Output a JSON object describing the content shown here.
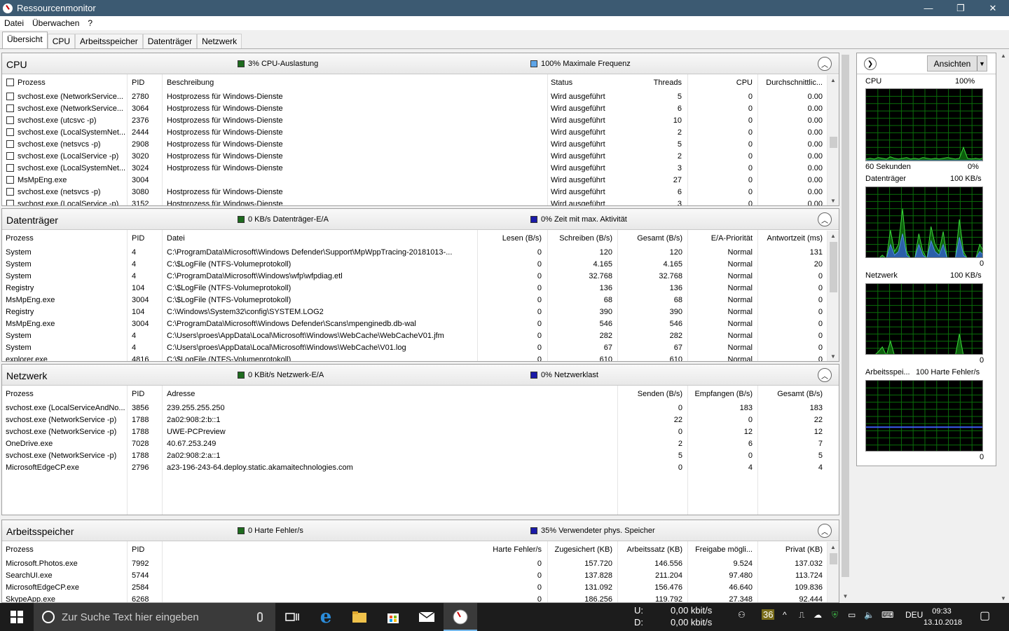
{
  "window": {
    "title": "Ressourcenmonitor",
    "controls": [
      "—",
      "❐",
      "✕"
    ]
  },
  "menu": [
    "Datei",
    "Überwachen",
    "?"
  ],
  "tabs": [
    "Übersicht",
    "CPU",
    "Arbeitsspeicher",
    "Datenträger",
    "Netzwerk"
  ],
  "cpu": {
    "title": "CPU",
    "stat1": "3% CPU-Auslastung",
    "stat1_color": "#1e6b1e",
    "stat2": "100% Maximale Frequenz",
    "stat2_color": "#5ea5e8",
    "headers": [
      "Prozess",
      "PID",
      "Beschreibung",
      "Status",
      "Threads",
      "CPU",
      "Durchschnittlic..."
    ],
    "rows": [
      [
        "svchost.exe (NetworkService...",
        "2780",
        "Hostprozess für Windows-Dienste",
        "Wird ausgeführt",
        "5",
        "0",
        "0.00"
      ],
      [
        "svchost.exe (NetworkService...",
        "3064",
        "Hostprozess für Windows-Dienste",
        "Wird ausgeführt",
        "6",
        "0",
        "0.00"
      ],
      [
        "svchost.exe (utcsvc -p)",
        "2376",
        "Hostprozess für Windows-Dienste",
        "Wird ausgeführt",
        "10",
        "0",
        "0.00"
      ],
      [
        "svchost.exe (LocalSystemNet...",
        "2444",
        "Hostprozess für Windows-Dienste",
        "Wird ausgeführt",
        "2",
        "0",
        "0.00"
      ],
      [
        "svchost.exe (netsvcs -p)",
        "2908",
        "Hostprozess für Windows-Dienste",
        "Wird ausgeführt",
        "5",
        "0",
        "0.00"
      ],
      [
        "svchost.exe (LocalService -p)",
        "3020",
        "Hostprozess für Windows-Dienste",
        "Wird ausgeführt",
        "2",
        "0",
        "0.00"
      ],
      [
        "svchost.exe (LocalSystemNet...",
        "3024",
        "Hostprozess für Windows-Dienste",
        "Wird ausgeführt",
        "3",
        "0",
        "0.00"
      ],
      [
        "MsMpEng.exe",
        "3004",
        "",
        "Wird ausgeführt",
        "27",
        "0",
        "0.00"
      ],
      [
        "svchost.exe (netsvcs -p)",
        "3080",
        "Hostprozess für Windows-Dienste",
        "Wird ausgeführt",
        "6",
        "0",
        "0.00"
      ],
      [
        "svchost.exe (LocalService -p)",
        "3152",
        "Hostprozess für Windows-Dienste",
        "Wird ausgeführt",
        "3",
        "0",
        "0.00"
      ]
    ]
  },
  "disk": {
    "title": "Datenträger",
    "stat1": "0 KB/s Datenträger-E/A",
    "stat1_color": "#1e6b1e",
    "stat2": "0% Zeit mit max. Aktivität",
    "stat2_color": "#1a1aa8",
    "headers": [
      "Prozess",
      "PID",
      "Datei",
      "Lesen (B/s)",
      "Schreiben (B/s)",
      "Gesamt (B/s)",
      "E/A-Priorität",
      "Antwortzeit (ms)"
    ],
    "rows": [
      [
        "System",
        "4",
        "C:\\ProgramData\\Microsoft\\Windows Defender\\Support\\MpWppTracing-20181013-...",
        "0",
        "120",
        "120",
        "Normal",
        "131"
      ],
      [
        "System",
        "4",
        "C:\\$LogFile (NTFS-Volumeprotokoll)",
        "0",
        "4.165",
        "4.165",
        "Normal",
        "20"
      ],
      [
        "System",
        "4",
        "C:\\ProgramData\\Microsoft\\Windows\\wfp\\wfpdiag.etl",
        "0",
        "32.768",
        "32.768",
        "Normal",
        "0"
      ],
      [
        "Registry",
        "104",
        "C:\\$LogFile (NTFS-Volumeprotokoll)",
        "0",
        "136",
        "136",
        "Normal",
        "0"
      ],
      [
        "MsMpEng.exe",
        "3004",
        "C:\\$LogFile (NTFS-Volumeprotokoll)",
        "0",
        "68",
        "68",
        "Normal",
        "0"
      ],
      [
        "Registry",
        "104",
        "C:\\Windows\\System32\\config\\SYSTEM.LOG2",
        "0",
        "390",
        "390",
        "Normal",
        "0"
      ],
      [
        "MsMpEng.exe",
        "3004",
        "C:\\ProgramData\\Microsoft\\Windows Defender\\Scans\\mpenginedb.db-wal",
        "0",
        "546",
        "546",
        "Normal",
        "0"
      ],
      [
        "System",
        "4",
        "C:\\Users\\proes\\AppData\\Local\\Microsoft\\Windows\\WebCache\\WebCacheV01.jfm",
        "0",
        "282",
        "282",
        "Normal",
        "0"
      ],
      [
        "System",
        "4",
        "C:\\Users\\proes\\AppData\\Local\\Microsoft\\Windows\\WebCache\\V01.log",
        "0",
        "67",
        "67",
        "Normal",
        "0"
      ],
      [
        "explorer.exe",
        "4816",
        "C:\\$LogFile (NTFS-Volumeprotokoll)",
        "0",
        "610",
        "610",
        "Normal",
        "0"
      ]
    ]
  },
  "net": {
    "title": "Netzwerk",
    "stat1": "0 KBit/s Netzwerk-E/A",
    "stat1_color": "#1e6b1e",
    "stat2": "0% Netzwerklast",
    "stat2_color": "#1a1aa8",
    "headers": [
      "Prozess",
      "PID",
      "Adresse",
      "Senden (B/s)",
      "Empfangen (B/s)",
      "Gesamt (B/s)"
    ],
    "rows": [
      [
        "svchost.exe (LocalServiceAndNo...",
        "3856",
        "239.255.255.250",
        "0",
        "183",
        "183"
      ],
      [
        "svchost.exe (NetworkService -p)",
        "1788",
        "2a02:908:2:b::1",
        "22",
        "0",
        "22"
      ],
      [
        "svchost.exe (NetworkService -p)",
        "1788",
        "UWE-PCPreview",
        "0",
        "12",
        "12"
      ],
      [
        "OneDrive.exe",
        "7028",
        "40.67.253.249",
        "2",
        "6",
        "7"
      ],
      [
        "svchost.exe (NetworkService -p)",
        "1788",
        "2a02:908:2:a::1",
        "5",
        "0",
        "5"
      ],
      [
        "MicrosoftEdgeCP.exe",
        "2796",
        "a23-196-243-64.deploy.static.akamaitechnologies.com",
        "0",
        "4",
        "4"
      ]
    ]
  },
  "mem": {
    "title": "Arbeitsspeicher",
    "stat1": "0 Harte Fehler/s",
    "stat1_color": "#1e6b1e",
    "stat2": "35% Verwendeter phys. Speicher",
    "stat2_color": "#1a1aa8",
    "headers": [
      "Prozess",
      "PID",
      "Harte Fehler/s",
      "Zugesichert (KB)",
      "Arbeitssatz (KB)",
      "Freigabe mögli...",
      "Privat (KB)"
    ],
    "rows": [
      [
        "Microsoft.Photos.exe",
        "7992",
        "0",
        "157.720",
        "146.556",
        "9.524",
        "137.032"
      ],
      [
        "SearchUI.exe",
        "5744",
        "0",
        "137.828",
        "211.204",
        "97.480",
        "113.724"
      ],
      [
        "MicrosoftEdgeCP.exe",
        "2584",
        "0",
        "131.092",
        "156.476",
        "46.640",
        "109.836"
      ],
      [
        "SkypeApp.exe",
        "6268",
        "0",
        "186.256",
        "119.792",
        "27.348",
        "92.444"
      ]
    ]
  },
  "side": {
    "views_label": "Ansichten",
    "cpu_label": "CPU",
    "cpu_max": "100%",
    "cpu_time": "60 Sekunden",
    "cpu_min": "0%",
    "disk_label": "Datenträger",
    "disk_max": "100 KB/s",
    "disk_min": "0",
    "net_label": "Netzwerk",
    "net_max": "100 KB/s",
    "net_min": "0",
    "mem_label": "Arbeitsspei...",
    "mem_max": "100 Harte Fehler/s",
    "mem_min": "0",
    "cpu_usage_series": [
      0.04,
      0.05,
      0.04,
      0.06,
      0.05,
      0.04,
      0.07,
      0.05,
      0.04,
      0.05,
      0.06,
      0.04,
      0.05,
      0.04,
      0.06,
      0.05,
      0.04,
      0.05,
      0.04,
      0.05,
      0.06,
      0.05,
      0.04,
      0.05,
      0.2,
      0.05,
      0.04,
      0.05,
      0.04,
      0.06
    ],
    "cpu_freq_series": [
      0.02,
      0.02,
      0.02,
      0.02,
      0.02,
      0.02,
      0.02,
      0.02,
      0.02,
      0.02,
      0.02,
      0.02,
      0.02,
      0.02,
      0.02,
      0.02,
      0.02,
      0.02,
      0.02,
      0.02,
      0.02,
      0.02,
      0.02,
      0.02,
      0.02,
      0.02,
      0.02,
      0.02,
      0.02,
      0.02
    ],
    "disk_io_series": [
      0,
      0,
      0,
      0,
      0.05,
      0,
      0.4,
      0.1,
      0.2,
      0.7,
      0.1,
      0,
      0,
      0.35,
      0.1,
      0,
      0.45,
      0.2,
      0.1,
      0.38,
      0,
      0,
      0,
      0.55,
      0.1,
      0,
      0,
      0,
      0.2,
      0.1
    ],
    "disk_active_series": [
      0,
      0,
      0,
      0,
      0.02,
      0,
      0.2,
      0.05,
      0.1,
      0.35,
      0.05,
      0,
      0,
      0.2,
      0.05,
      0,
      0.25,
      0.1,
      0.05,
      0.2,
      0,
      0,
      0,
      0.3,
      0.05,
      0,
      0,
      0,
      0.1,
      0.05
    ],
    "net_io_series": [
      0,
      0,
      0,
      0.05,
      0.12,
      0,
      0.2,
      0,
      0,
      0,
      0,
      0,
      0,
      0,
      0,
      0,
      0,
      0,
      0,
      0,
      0,
      0,
      0,
      0.3,
      0,
      0,
      0,
      0,
      0,
      0
    ],
    "mem_faults_series": [
      0,
      0,
      0,
      0,
      0,
      0,
      0,
      0,
      0,
      0,
      0,
      0,
      0,
      0,
      0,
      0,
      0,
      0,
      0,
      0,
      0,
      0,
      0,
      0,
      0,
      0,
      0,
      0,
      0,
      0
    ],
    "mem_used_fraction": 0.35
  },
  "taskbar": {
    "search_placeholder": "Zur Suche Text hier eingeben",
    "net_up_label": "U:",
    "net_up_val": "0,00 kbit/s",
    "net_down_label": "D:",
    "net_down_val": "0,00 kbit/s",
    "badge": "36",
    "lang": "DEU",
    "time": "09:33",
    "date": "13.10.2018"
  }
}
